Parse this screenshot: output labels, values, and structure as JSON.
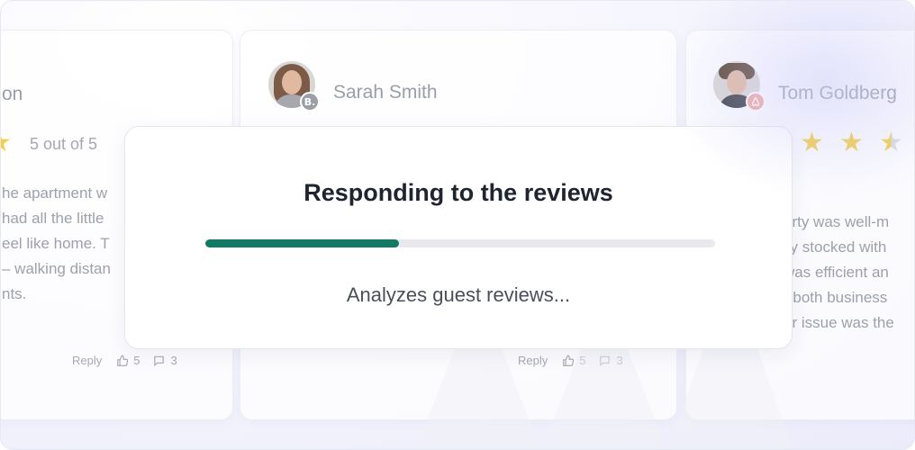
{
  "cards": [
    {
      "name_visible": "on",
      "rating_text": "5 out of 5",
      "review_lines": [
        "he apartment w",
        " had all the little",
        "eel like home. T",
        "– walking distan",
        "nts."
      ],
      "footer": {
        "reply_label": "Reply",
        "likes": "5",
        "comments": "3"
      }
    },
    {
      "name_visible": "Sarah Smith",
      "platform_badge": "B.",
      "platform_color": "#9a9ea6",
      "footer": {
        "reply_label": "Reply",
        "likes": "5",
        "comments": "3"
      }
    },
    {
      "name_visible": "Tom Goldberg",
      "platform_badge": "airbnb-icon",
      "platform_color": "#f0a9a0",
      "stars": 2.5,
      "review_lines": [
        "erty was well-m",
        "lly stocked with",
        "was efficient an",
        "r both business",
        "or issue was the"
      ]
    }
  ],
  "modal": {
    "title": "Responding to the reviews",
    "progress": 0.38,
    "status": "Analyzes guest reviews...",
    "accent_color": "#127a63"
  }
}
